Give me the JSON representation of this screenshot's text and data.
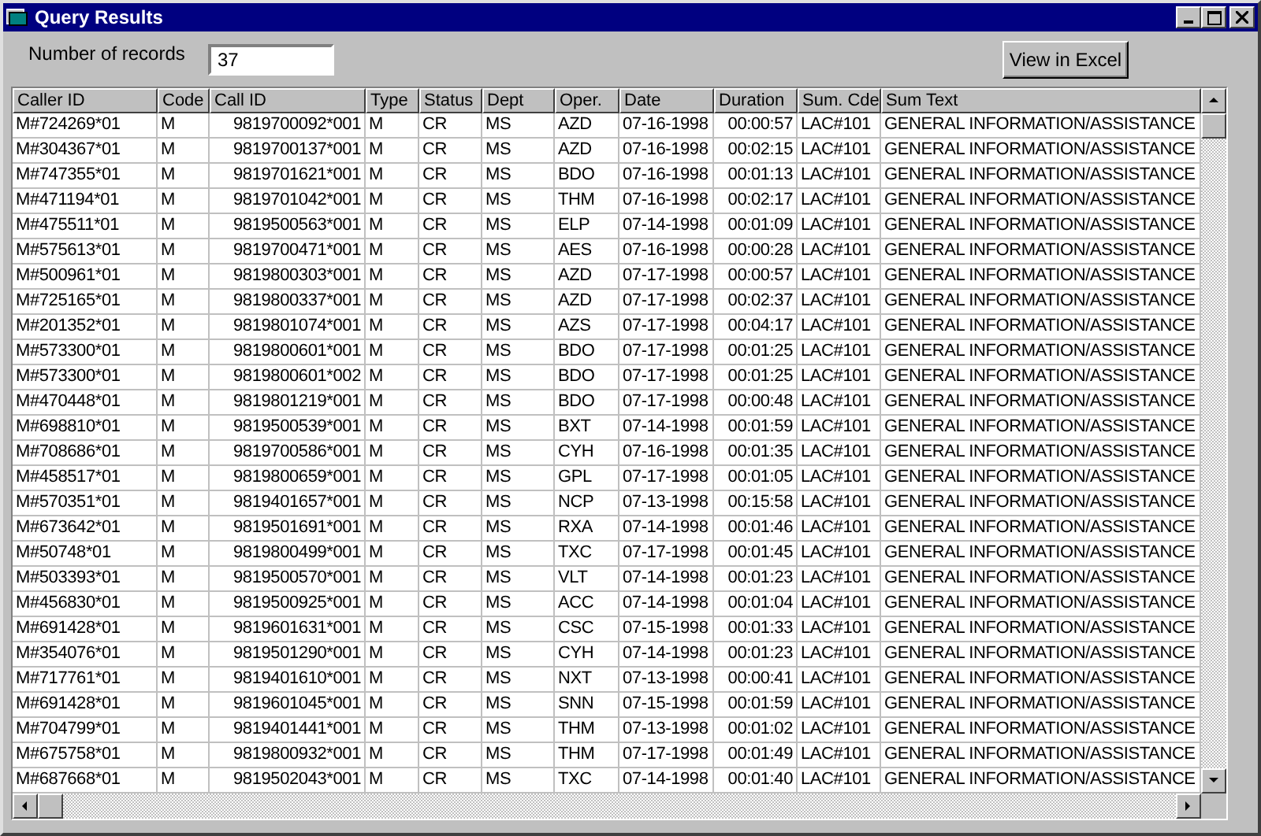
{
  "window": {
    "title": "Query Results"
  },
  "record_count": {
    "label": "Number of records",
    "value": "37"
  },
  "excel_button": "View in Excel",
  "table": {
    "columns": [
      "Caller ID",
      "Code",
      "Call ID",
      "Type",
      "Status",
      "Dept",
      "Oper.",
      "Date",
      "Duration",
      "Sum. Cde",
      "Sum Text"
    ],
    "rows": [
      [
        "M#724269*01",
        "M",
        "9819700092*001",
        "M",
        "CR",
        "MS",
        "AZD",
        "07-16-1998",
        "00:00:57",
        "LAC#101",
        "GENERAL INFORMATION/ASSISTANCE"
      ],
      [
        "M#304367*01",
        "M",
        "9819700137*001",
        "M",
        "CR",
        "MS",
        "AZD",
        "07-16-1998",
        "00:02:15",
        "LAC#101",
        "GENERAL INFORMATION/ASSISTANCE"
      ],
      [
        "M#747355*01",
        "M",
        "9819701621*001",
        "M",
        "CR",
        "MS",
        "BDO",
        "07-16-1998",
        "00:01:13",
        "LAC#101",
        "GENERAL INFORMATION/ASSISTANCE"
      ],
      [
        "M#471194*01",
        "M",
        "9819701042*001",
        "M",
        "CR",
        "MS",
        "THM",
        "07-16-1998",
        "00:02:17",
        "LAC#101",
        "GENERAL INFORMATION/ASSISTANCE"
      ],
      [
        "M#475511*01",
        "M",
        "9819500563*001",
        "M",
        "CR",
        "MS",
        "ELP",
        "07-14-1998",
        "00:01:09",
        "LAC#101",
        "GENERAL INFORMATION/ASSISTANCE"
      ],
      [
        "M#575613*01",
        "M",
        "9819700471*001",
        "M",
        "CR",
        "MS",
        "AES",
        "07-16-1998",
        "00:00:28",
        "LAC#101",
        "GENERAL INFORMATION/ASSISTANCE"
      ],
      [
        "M#500961*01",
        "M",
        "9819800303*001",
        "M",
        "CR",
        "MS",
        "AZD",
        "07-17-1998",
        "00:00:57",
        "LAC#101",
        "GENERAL INFORMATION/ASSISTANCE"
      ],
      [
        "M#725165*01",
        "M",
        "9819800337*001",
        "M",
        "CR",
        "MS",
        "AZD",
        "07-17-1998",
        "00:02:37",
        "LAC#101",
        "GENERAL INFORMATION/ASSISTANCE"
      ],
      [
        "M#201352*01",
        "M",
        "9819801074*001",
        "M",
        "CR",
        "MS",
        "AZS",
        "07-17-1998",
        "00:04:17",
        "LAC#101",
        "GENERAL INFORMATION/ASSISTANCE"
      ],
      [
        "M#573300*01",
        "M",
        "9819800601*001",
        "M",
        "CR",
        "MS",
        "BDO",
        "07-17-1998",
        "00:01:25",
        "LAC#101",
        "GENERAL INFORMATION/ASSISTANCE"
      ],
      [
        "M#573300*01",
        "M",
        "9819800601*002",
        "M",
        "CR",
        "MS",
        "BDO",
        "07-17-1998",
        "00:01:25",
        "LAC#101",
        "GENERAL INFORMATION/ASSISTANCE"
      ],
      [
        "M#470448*01",
        "M",
        "9819801219*001",
        "M",
        "CR",
        "MS",
        "BDO",
        "07-17-1998",
        "00:00:48",
        "LAC#101",
        "GENERAL INFORMATION/ASSISTANCE"
      ],
      [
        "M#698810*01",
        "M",
        "9819500539*001",
        "M",
        "CR",
        "MS",
        "BXT",
        "07-14-1998",
        "00:01:59",
        "LAC#101",
        "GENERAL INFORMATION/ASSISTANCE"
      ],
      [
        "M#708686*01",
        "M",
        "9819700586*001",
        "M",
        "CR",
        "MS",
        "CYH",
        "07-16-1998",
        "00:01:35",
        "LAC#101",
        "GENERAL INFORMATION/ASSISTANCE"
      ],
      [
        "M#458517*01",
        "M",
        "9819800659*001",
        "M",
        "CR",
        "MS",
        "GPL",
        "07-17-1998",
        "00:01:05",
        "LAC#101",
        "GENERAL INFORMATION/ASSISTANCE"
      ],
      [
        "M#570351*01",
        "M",
        "9819401657*001",
        "M",
        "CR",
        "MS",
        "NCP",
        "07-13-1998",
        "00:15:58",
        "LAC#101",
        "GENERAL INFORMATION/ASSISTANCE"
      ],
      [
        "M#673642*01",
        "M",
        "9819501691*001",
        "M",
        "CR",
        "MS",
        "RXA",
        "07-14-1998",
        "00:01:46",
        "LAC#101",
        "GENERAL INFORMATION/ASSISTANCE"
      ],
      [
        "M#50748*01",
        "M",
        "9819800499*001",
        "M",
        "CR",
        "MS",
        "TXC",
        "07-17-1998",
        "00:01:45",
        "LAC#101",
        "GENERAL INFORMATION/ASSISTANCE"
      ],
      [
        "M#503393*01",
        "M",
        "9819500570*001",
        "M",
        "CR",
        "MS",
        "VLT",
        "07-14-1998",
        "00:01:23",
        "LAC#101",
        "GENERAL INFORMATION/ASSISTANCE"
      ],
      [
        "M#456830*01",
        "M",
        "9819500925*001",
        "M",
        "CR",
        "MS",
        "ACC",
        "07-14-1998",
        "00:01:04",
        "LAC#101",
        "GENERAL INFORMATION/ASSISTANCE"
      ],
      [
        "M#691428*01",
        "M",
        "9819601631*001",
        "M",
        "CR",
        "MS",
        "CSC",
        "07-15-1998",
        "00:01:33",
        "LAC#101",
        "GENERAL INFORMATION/ASSISTANCE"
      ],
      [
        "M#354076*01",
        "M",
        "9819501290*001",
        "M",
        "CR",
        "MS",
        "CYH",
        "07-14-1998",
        "00:01:23",
        "LAC#101",
        "GENERAL INFORMATION/ASSISTANCE"
      ],
      [
        "M#717761*01",
        "M",
        "9819401610*001",
        "M",
        "CR",
        "MS",
        "NXT",
        "07-13-1998",
        "00:00:41",
        "LAC#101",
        "GENERAL INFORMATION/ASSISTANCE"
      ],
      [
        "M#691428*01",
        "M",
        "9819601045*001",
        "M",
        "CR",
        "MS",
        "SNN",
        "07-15-1998",
        "00:01:59",
        "LAC#101",
        "GENERAL INFORMATION/ASSISTANCE"
      ],
      [
        "M#704799*01",
        "M",
        "9819401441*001",
        "M",
        "CR",
        "MS",
        "THM",
        "07-13-1998",
        "00:01:02",
        "LAC#101",
        "GENERAL INFORMATION/ASSISTANCE"
      ],
      [
        "M#675758*01",
        "M",
        "9819800932*001",
        "M",
        "CR",
        "MS",
        "THM",
        "07-17-1998",
        "00:01:49",
        "LAC#101",
        "GENERAL INFORMATION/ASSISTANCE"
      ],
      [
        "M#687668*01",
        "M",
        "9819502043*001",
        "M",
        "CR",
        "MS",
        "TXC",
        "07-14-1998",
        "00:01:40",
        "LAC#101",
        "GENERAL INFORMATION/ASSISTANCE"
      ]
    ]
  }
}
